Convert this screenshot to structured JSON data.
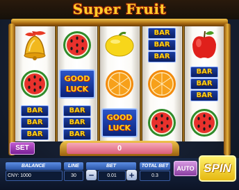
{
  "game": {
    "title": "Super Fruit",
    "win_amount": "0",
    "set_label": "SET",
    "auto_label": "AUTO",
    "spin_label": "SPIN"
  },
  "reels": [
    [
      "bell",
      "watermelon",
      "bar"
    ],
    [
      "watermelon",
      "good-luck",
      "bar"
    ],
    [
      "lemon",
      "orange",
      "good-luck"
    ],
    [
      "bar",
      "orange",
      "watermelon"
    ],
    [
      "apple",
      "bar",
      "watermelon"
    ]
  ],
  "symbols": {
    "bar_text": "BAR",
    "good_luck_line1": "GOOD",
    "good_luck_line2": "LUCK"
  },
  "status": {
    "balance_label": "BALANCE",
    "balance_value": "CNY: 1000",
    "line_label": "LINE",
    "line_value": "30",
    "bet_label": "BET",
    "bet_value": "0.01",
    "total_bet_label": "TOTAL BET",
    "total_bet_value": "0.3",
    "minus": "−",
    "plus": "+"
  },
  "colors": {
    "title": "#ffcf2a",
    "frame_gold": "#e7b23a",
    "win_display": "#e67b93",
    "spin": "#f5d43a",
    "auto": "#b565c9"
  }
}
